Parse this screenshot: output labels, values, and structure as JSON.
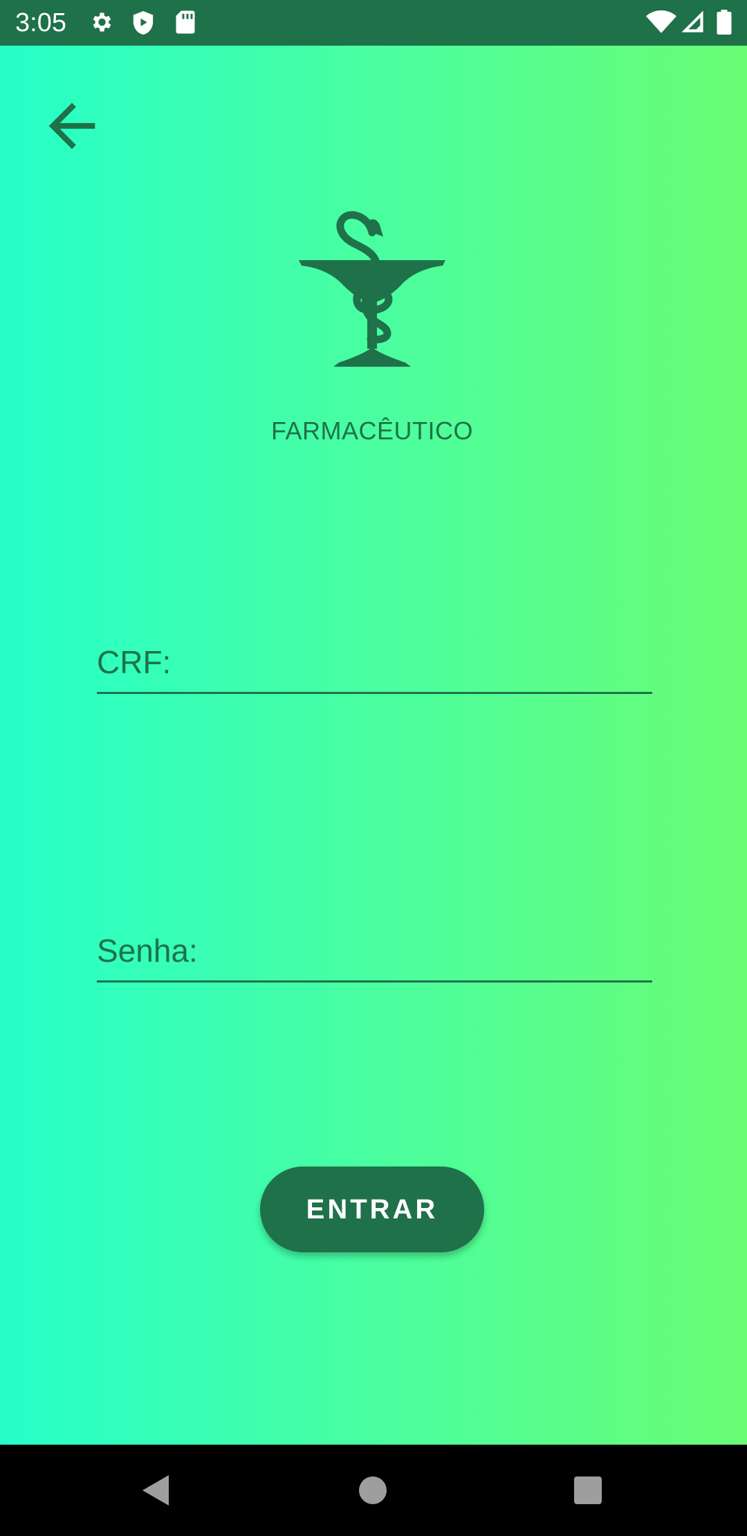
{
  "status_bar": {
    "time": "3:05",
    "left_icons": [
      "gear-icon",
      "shield-play-icon",
      "sd-card-icon"
    ],
    "right_icons": [
      "wifi-icon",
      "cell-signal-icon",
      "battery-icon"
    ],
    "background": "#1f7149"
  },
  "header": {
    "back_icon": "arrow-left-icon"
  },
  "logo": {
    "icon": "pharmacy-bowl-of-hygieia-icon"
  },
  "role_title": "FARMACÊUTICO",
  "form": {
    "crf": {
      "placeholder": "CRF:",
      "value": ""
    },
    "password": {
      "placeholder": "Senha:",
      "value": ""
    }
  },
  "enter_button": {
    "label": "ENTRAR"
  },
  "nav_bar": {
    "icons": [
      "back-triangle-icon",
      "home-circle-icon",
      "recents-square-icon"
    ]
  },
  "colors": {
    "accent": "#1f7149",
    "gradient_start": "#26ffc9",
    "gradient_end": "#6afd74",
    "nav_icon": "#9e9e9e"
  }
}
